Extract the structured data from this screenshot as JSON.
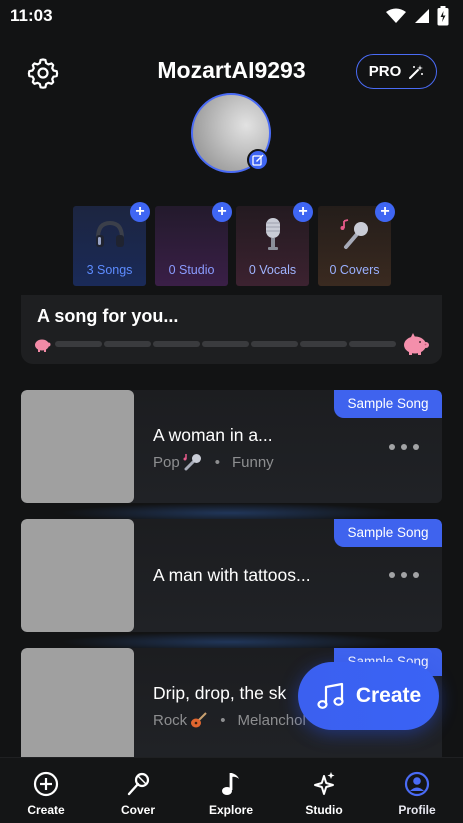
{
  "status_bar": {
    "time": "11:03"
  },
  "header": {
    "username": "MozartAI9293",
    "pro_label": "PRO"
  },
  "stats": [
    {
      "label": "3 Songs",
      "icon": "headphones-icon"
    },
    {
      "label": "0 Studio",
      "icon": "studio-icon"
    },
    {
      "label": "0 Vocals",
      "icon": "microphone-icon"
    },
    {
      "label": "0 Covers",
      "icon": "karaoke-mic-icon"
    }
  ],
  "song_for_you": {
    "title": "A song for you..."
  },
  "songs": [
    {
      "tag": "Sample Song",
      "title": "A woman in a...",
      "genre": "Pop",
      "genre_icon": "microphone-emoji-icon",
      "mood": "Funny"
    },
    {
      "tag": "Sample Song",
      "title": "A man with tattoos..."
    },
    {
      "tag": "Sample Song",
      "title": "Drip, drop, the sk",
      "genre": "Rock",
      "genre_icon": "guitar-emoji-icon",
      "mood": "Melanchol"
    }
  ],
  "fab": {
    "label": "Create"
  },
  "nav": [
    {
      "label": "Create",
      "icon": "plus-circle-icon"
    },
    {
      "label": "Cover",
      "icon": "microphone-icon"
    },
    {
      "label": "Explore",
      "icon": "music-note-icon"
    },
    {
      "label": "Studio",
      "icon": "sparkle-icon"
    },
    {
      "label": "Profile",
      "icon": "profile-icon",
      "active": true
    }
  ],
  "colors": {
    "accent": "#3f66f3",
    "background": "#121314",
    "profile_active": "#4a6bf5"
  }
}
